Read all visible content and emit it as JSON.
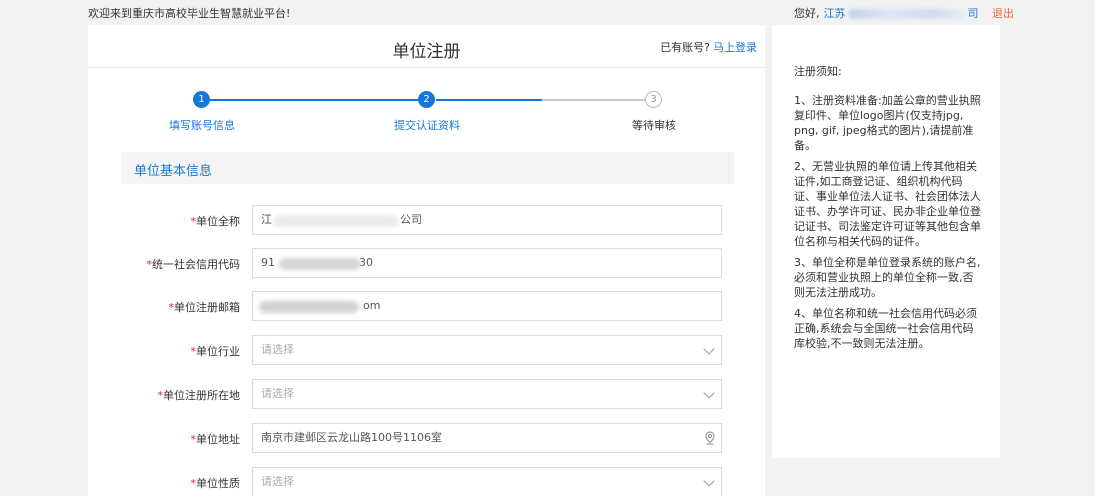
{
  "topbar": {
    "welcome": "欢迎来到重庆市高校毕业生智慧就业平台!",
    "greeting": "您好,",
    "company_prefix": "江苏",
    "company_suffix": "司",
    "logout": "退出"
  },
  "header": {
    "title": "单位注册",
    "have_account": "已有账号?",
    "login_link": "马上登录"
  },
  "steps": [
    {
      "num": "1",
      "label": "填写账号信息",
      "state": "done"
    },
    {
      "num": "2",
      "label": "提交认证资料",
      "state": "active"
    },
    {
      "num": "3",
      "label": "等待审核",
      "state": "pending"
    }
  ],
  "section_title": "单位基本信息",
  "form": {
    "full_name": {
      "label": "单位全称",
      "value_start": "江",
      "value_end": "公司"
    },
    "credit_code": {
      "label": "统一社会信用代码",
      "value_start": "91",
      "value_end": "30"
    },
    "email": {
      "label": "单位注册邮箱",
      "value_end": "om"
    },
    "industry": {
      "label": "单位行业",
      "placeholder": "请选择"
    },
    "location": {
      "label": "单位注册所在地",
      "placeholder": "请选择"
    },
    "address": {
      "label": "单位地址",
      "value": "南京市建邺区云龙山路100号1106室"
    },
    "nature": {
      "label": "单位性质",
      "placeholder": "请选择"
    }
  },
  "required_mark": "*",
  "sidebar": {
    "title": "注册须知:",
    "notes": [
      "1、注册资料准备:加盖公章的营业执照复印件、单位logo图片(仅支持jpg, png, gif, jpeg格式的图片),请提前准备。",
      "2、无营业执照的单位请上传其他相关证件,如工商登记证、组织机构代码证、事业单位法人证书、社会团体法人证书、办学许可证、民办非企业单位登记证书、司法鉴定许可证等其他包含单位名称与相关代码的证件。",
      "3、单位全称是单位登录系统的账户名,必须和营业执照上的单位全称一致,否则无法注册成功。",
      "4、单位名称和统一社会信用代码必须正确,系统会与全国统一社会信用代码库校验,不一致则无法注册。"
    ]
  },
  "colors": {
    "accent": "#1677d9",
    "required": "#e02020",
    "logout": "#f26b3a"
  }
}
